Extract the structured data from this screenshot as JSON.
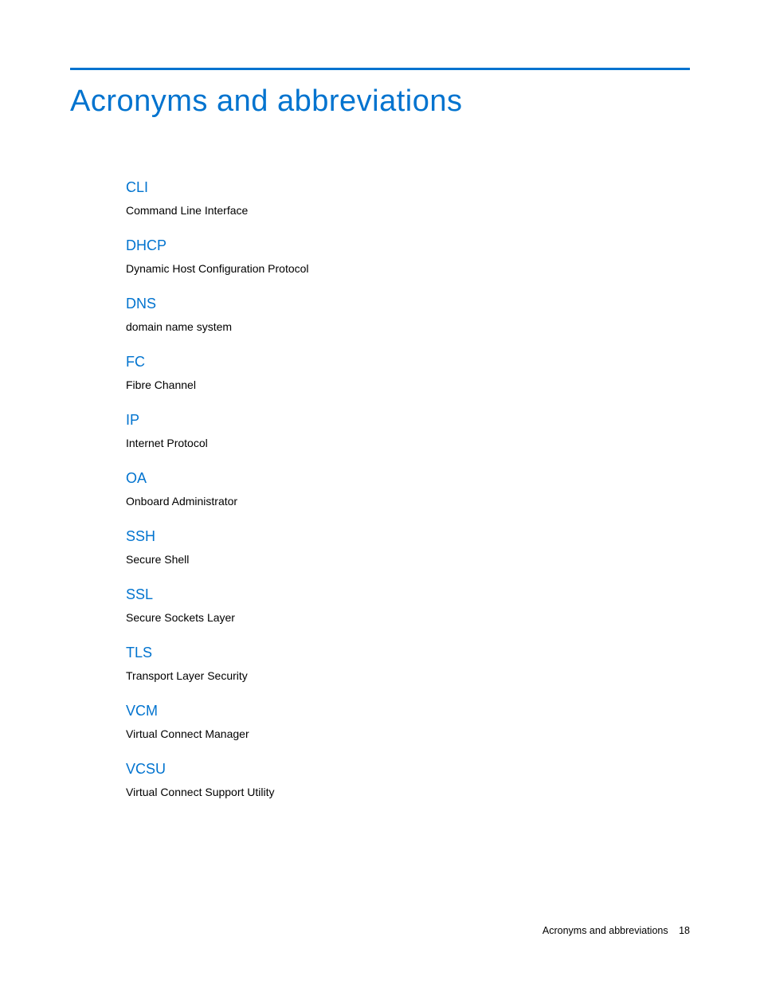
{
  "title": "Acronyms and abbreviations",
  "entries": [
    {
      "term": "CLI",
      "definition": "Command Line Interface"
    },
    {
      "term": "DHCP",
      "definition": "Dynamic Host Configuration Protocol"
    },
    {
      "term": "DNS",
      "definition": "domain name system"
    },
    {
      "term": "FC",
      "definition": "Fibre Channel"
    },
    {
      "term": "IP",
      "definition": "Internet Protocol"
    },
    {
      "term": "OA",
      "definition": "Onboard Administrator"
    },
    {
      "term": "SSH",
      "definition": "Secure Shell"
    },
    {
      "term": "SSL",
      "definition": "Secure Sockets Layer"
    },
    {
      "term": "TLS",
      "definition": "Transport Layer Security"
    },
    {
      "term": "VCM",
      "definition": "Virtual Connect Manager"
    },
    {
      "term": "VCSU",
      "definition": "Virtual Connect Support Utility"
    }
  ],
  "footer": {
    "section": "Acronyms and abbreviations",
    "page": "18"
  }
}
